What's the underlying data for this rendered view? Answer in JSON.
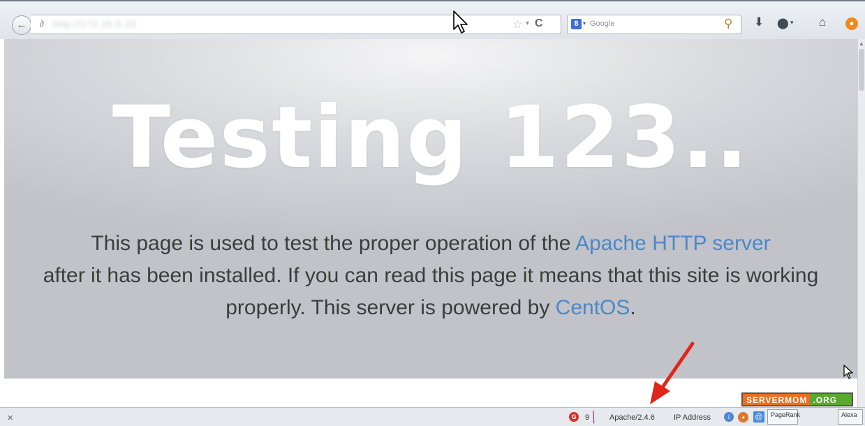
{
  "toolbar": {
    "back_glyph": "←",
    "favicon_glyph": "∂",
    "url": "http://172.16.0.20",
    "star_glyph": "☆",
    "star_drop_glyph": "▾",
    "reload_glyph": "C",
    "search_engine_letter": "8",
    "search_engine_drop": "▾",
    "search_placeholder": "Google",
    "magnifier_glyph": "⚲",
    "download_glyph": "⬇",
    "addon_glyph": "⬤",
    "addon_drop_glyph": "▾",
    "home_glyph": "⌂",
    "extra_glyph": "●"
  },
  "page": {
    "headline": "Testing 123..",
    "message_part1": "This page is used to test the proper operation of the ",
    "link_apache": "Apache HTTP server",
    "message_part2": " after it has been installed. If you can read this page it means that this site is working properly. This server is powered by ",
    "link_centos": "CentOS",
    "message_part3": "."
  },
  "scrollbar": {
    "up_glyph": "▲"
  },
  "watermark": {
    "left": "SERVERMOM",
    "right": ".ORG"
  },
  "statusbar": {
    "close_glyph": "✕",
    "red_icon_letter": "G",
    "count": "9",
    "feather_glyph": "╲",
    "server": "Apache/2.4.6",
    "ip_label": "IP Address",
    "globe_letter": "i",
    "ff_letter": "◕",
    "at_letter": "@",
    "pagerank": "PageRank",
    "alexa": "Alexa"
  },
  "colors": {
    "link": "#4a88c8",
    "annotation_arrow": "#e0261b",
    "watermark_orange": "#e87022",
    "watermark_green": "#5aa82e"
  }
}
